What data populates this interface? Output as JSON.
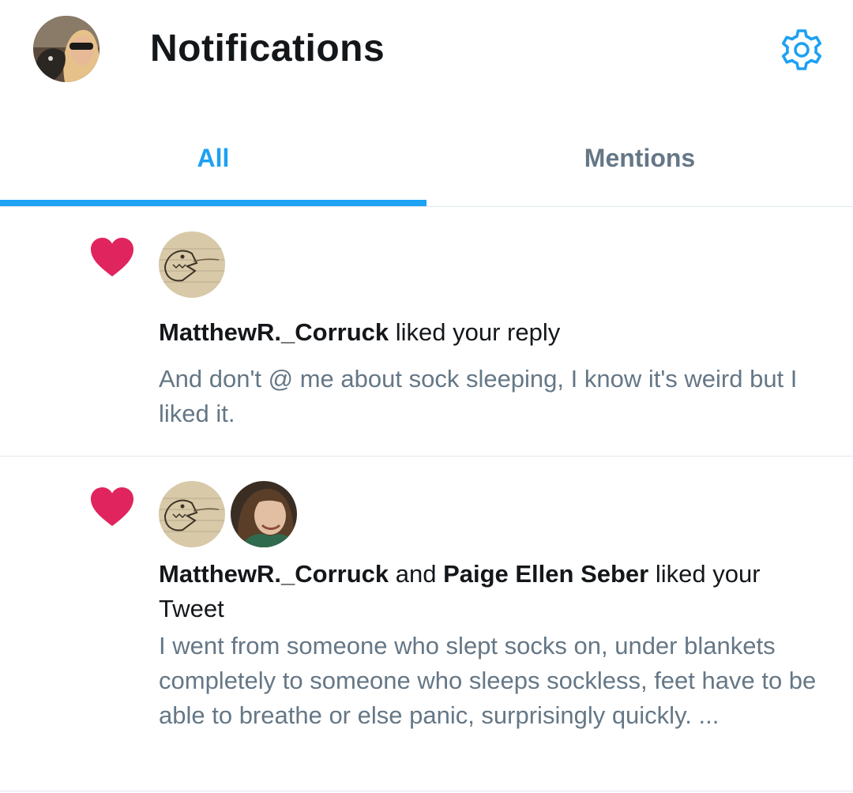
{
  "header": {
    "title": "Notifications",
    "profile_avatar_icon": "user-avatar",
    "settings_icon": "gear-icon"
  },
  "tabs": [
    {
      "label": "All",
      "active": true
    },
    {
      "label": "Mentions",
      "active": false
    }
  ],
  "colors": {
    "accent": "#1da1f2",
    "like": "#e0245e",
    "secondary_text": "#657786",
    "divider": "#e1e8ed"
  },
  "notifications": [
    {
      "type": "like",
      "icon": "heart-icon",
      "actor1": "MatthewR._Corruck",
      "action": " liked your reply",
      "snippet": "And don't @ me about sock sleeping, I know it's weird but I liked it."
    },
    {
      "type": "like",
      "icon": "heart-icon",
      "actor1": "MatthewR._Corruck",
      "conjunction": " and ",
      "actor2": "Paige Ellen Seber",
      "action": " liked your Tweet",
      "snippet": "I went from someone who slept socks on, under blankets completely to someone who sleeps sockless, feet have to be able to breathe or else panic, surprisingly quickly. ..."
    }
  ]
}
